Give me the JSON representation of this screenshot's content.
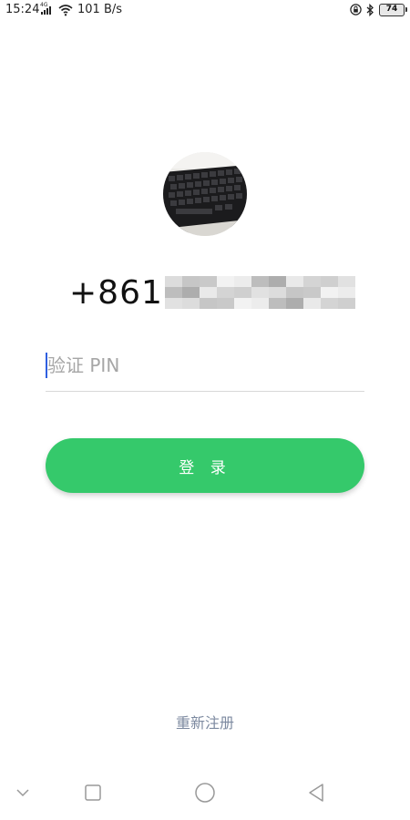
{
  "status_bar": {
    "time": "15:24",
    "network_type": "4G",
    "net_speed": "101 B/s",
    "battery": "74",
    "icons": [
      "signal-icon",
      "wifi-icon",
      "lock-icon",
      "bluetooth-icon",
      "battery-icon"
    ]
  },
  "login": {
    "phone_visible": "+861",
    "pin_placeholder": "验证 PIN",
    "login_button": "登 录",
    "reregister": "重新注册"
  },
  "nav_bar": {
    "icons": [
      "collapse-icon",
      "recent-apps-icon",
      "home-icon",
      "back-icon"
    ]
  },
  "colors": {
    "primary_button": "#35c96b",
    "link": "#7d8aa0",
    "cursor": "#2f5fe0",
    "placeholder": "#a6a6a6"
  }
}
